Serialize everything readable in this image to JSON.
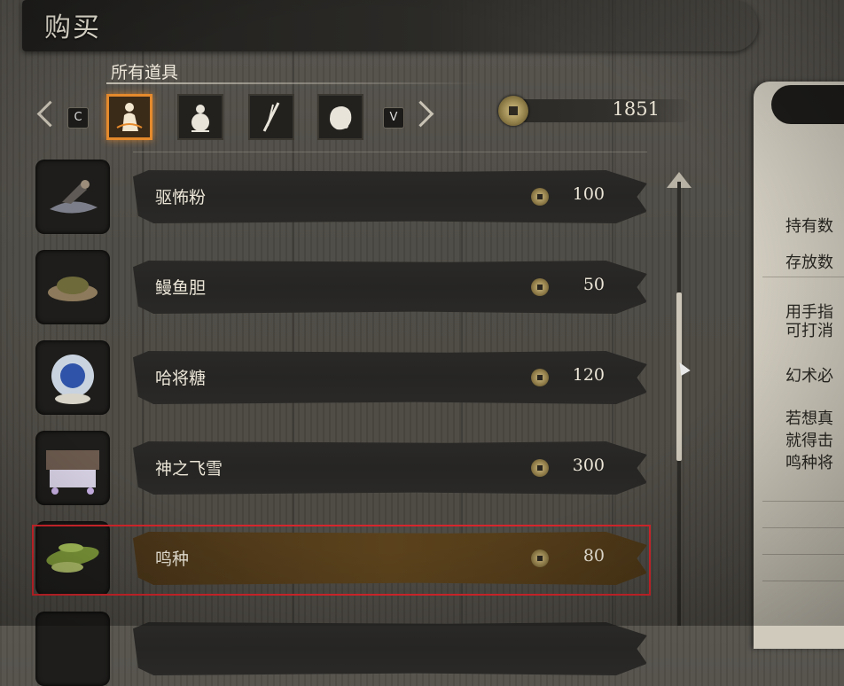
{
  "header": {
    "title": "购买"
  },
  "category": {
    "label": "所有道具"
  },
  "tabs": {
    "prev_key": "C",
    "next_key": "V",
    "items": [
      {
        "icon": "figure-item-icon",
        "active": true
      },
      {
        "icon": "gourd-icon",
        "active": false
      },
      {
        "icon": "tool-icon",
        "active": false
      },
      {
        "icon": "pouch-icon",
        "active": false
      }
    ]
  },
  "currency": {
    "amount": "1851",
    "icon": "sen-coin-icon"
  },
  "items": [
    {
      "name": "驱怖粉",
      "price": "100",
      "icon": "fear-powder-icon"
    },
    {
      "name": "鳗鱼胆",
      "price": "50",
      "icon": "eel-liver-icon"
    },
    {
      "name": "哈将糖",
      "price": "120",
      "icon": "candy-icon"
    },
    {
      "name": "神之飞雪",
      "price": "300",
      "icon": "divine-grass-icon"
    },
    {
      "name": "鸣种",
      "price": "80",
      "icon": "chirping-seed-icon",
      "selected": true
    }
  ],
  "detail_panel": {
    "lines": [
      "持有数",
      "存放数",
      "用手指",
      "可打消",
      "幻术必",
      "若想真",
      "就得击",
      "鸣种将"
    ]
  },
  "colors": {
    "highlight": "#d7262c",
    "active_tab": "#e58a2c",
    "selected_bar": "#5b421c"
  }
}
